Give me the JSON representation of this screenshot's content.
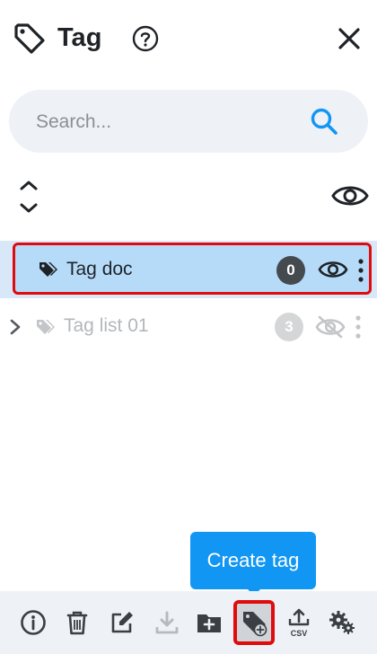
{
  "header": {
    "title": "Tag"
  },
  "search": {
    "placeholder": "Search..."
  },
  "tags": [
    {
      "label": "Tag doc",
      "count": "0"
    },
    {
      "label": "Tag list 01",
      "count": "3"
    }
  ],
  "tooltip": {
    "text": "Create tag"
  },
  "toolbar": {
    "items": [
      "info-icon",
      "trash-icon",
      "edit-icon",
      "download-icon",
      "new-folder-icon",
      "create-tag-icon",
      "export-csv-icon",
      "settings-icon"
    ],
    "csv_label": "CSV"
  },
  "colors": {
    "accent": "#1296f3",
    "selection_bg": "#b6dbf9",
    "highlight_border": "#e10b0b",
    "toolbar_bg": "#eef1f6"
  }
}
